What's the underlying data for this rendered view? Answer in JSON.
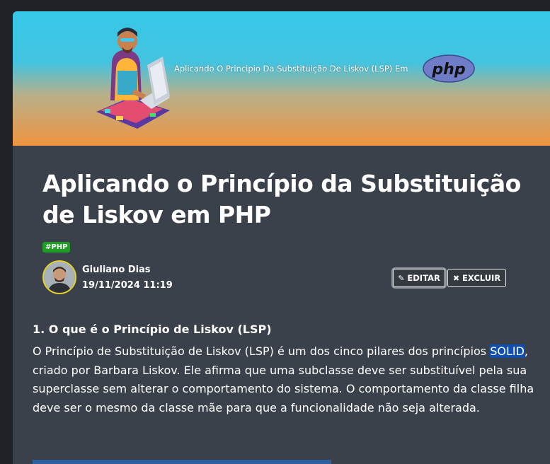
{
  "banner": {
    "title": "Aplicando O Principio Da Substituição De Liskov (LSP) Em",
    "logo_text": "php"
  },
  "article": {
    "title": "Aplicando o Princípio da Substituição de Liskov em PHP",
    "tag": "#PHP",
    "author": {
      "name": "Giuliano Dias",
      "date": "19/11/2024 11:19"
    },
    "actions": {
      "edit_label": "EDITAR",
      "delete_label": "EXCLUIR"
    },
    "section": {
      "heading": "1. O que é o Princípio de Liskov (LSP)",
      "paragraph_before": "O Princípio de Substituição de Liskov (LSP) é um dos cinco pilares dos princípios ",
      "highlight": "SOLID",
      "paragraph_after": ", criado por Barbara Liskov. Ele afirma que uma subclasse deve ser substituível pela sua superclasse sem alterar o comportamento do sistema. O comportamento da classe filha deve ser o mesmo da classe mãe para que a funcionalidade não seja alterada."
    }
  },
  "colors": {
    "background": "#1f2328",
    "card": "#3a414a",
    "tag": "#1e9e24",
    "highlight": "#0f4fae",
    "avatar_border": "#e3cf2c"
  },
  "icons": {
    "edit": "pencil-icon",
    "delete": "x-icon"
  }
}
